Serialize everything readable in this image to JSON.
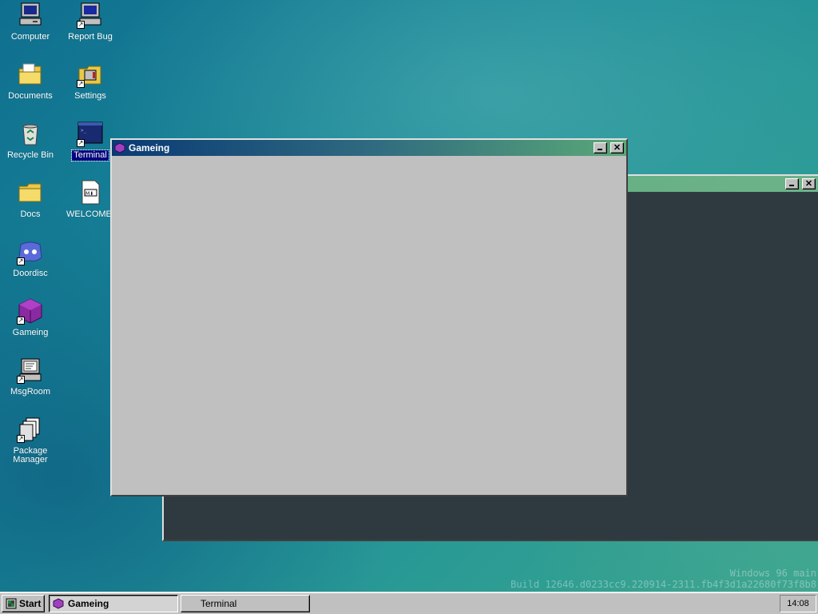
{
  "desktop": {
    "icons": [
      {
        "label": "Computer",
        "icon": "computer-icon"
      },
      {
        "label": "Report Bug",
        "icon": "report-bug-icon"
      },
      {
        "label": "Documents",
        "icon": "documents-folder-icon"
      },
      {
        "label": "Settings",
        "icon": "settings-icon"
      },
      {
        "label": "Recycle Bin",
        "icon": "recycle-bin-icon"
      },
      {
        "label": "Terminal",
        "icon": "terminal-icon"
      },
      {
        "label": "Docs",
        "icon": "folder-icon"
      },
      {
        "label": "WELCOME.",
        "icon": "markdown-file-icon"
      },
      {
        "label": "Doordisc",
        "icon": "doordisc-icon"
      },
      {
        "label": "Gameing",
        "icon": "gameing-cube-icon"
      },
      {
        "label": "MsgRoom",
        "icon": "msgroom-icon"
      },
      {
        "label": "Package Manager",
        "icon": "package-manager-icon"
      }
    ]
  },
  "windows": {
    "gameing": {
      "title": "Gameing",
      "body_color": "#c0c0c0"
    },
    "terminal": {
      "title": "",
      "body_color": "#2f3a40"
    }
  },
  "taskbar": {
    "start_label": "Start",
    "buttons": [
      {
        "label": "Gameing",
        "active": true
      },
      {
        "label": "Terminal",
        "active": false
      }
    ],
    "clock": "14:08"
  },
  "watermark": {
    "line1": "Windows 96 main",
    "line2": "Build 12646.d0233cc9.220914-2311.fb4f3d1a22680f73f8b8"
  },
  "colors": {
    "title_active_start": "#0a3a75",
    "title_active_end": "#5aa878",
    "selection": "#000080"
  }
}
